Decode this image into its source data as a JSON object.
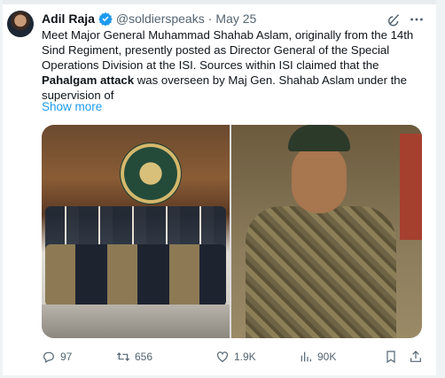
{
  "tweet": {
    "author_name": "Adil Raja",
    "author_handle": "@soldierspeaks",
    "separator": "·",
    "date": "May 25",
    "text_part1": "Meet Major General Muhammad Shahab Aslam, originally from the 14th Sind Regiment, presently posted as Director General of the Special Operations Division at the ISI. Sources within ISI claimed that the ",
    "text_bold": "Pahalgam attack",
    "text_part2": " was overseen by Maj Gen. Shahab Aslam under the supervision of",
    "show_more": "Show more"
  },
  "actions": {
    "replies": "97",
    "reposts": "656",
    "likes": "1.9K",
    "views": "90K"
  },
  "colors": {
    "link": "#1d9bf0",
    "muted": "#536471",
    "verified": "#1d9bf0"
  },
  "icons": [
    "verified-badge-icon",
    "grok-icon",
    "more-options-icon",
    "reply-icon",
    "repost-icon",
    "like-icon",
    "views-icon",
    "bookmark-icon",
    "share-icon"
  ]
}
